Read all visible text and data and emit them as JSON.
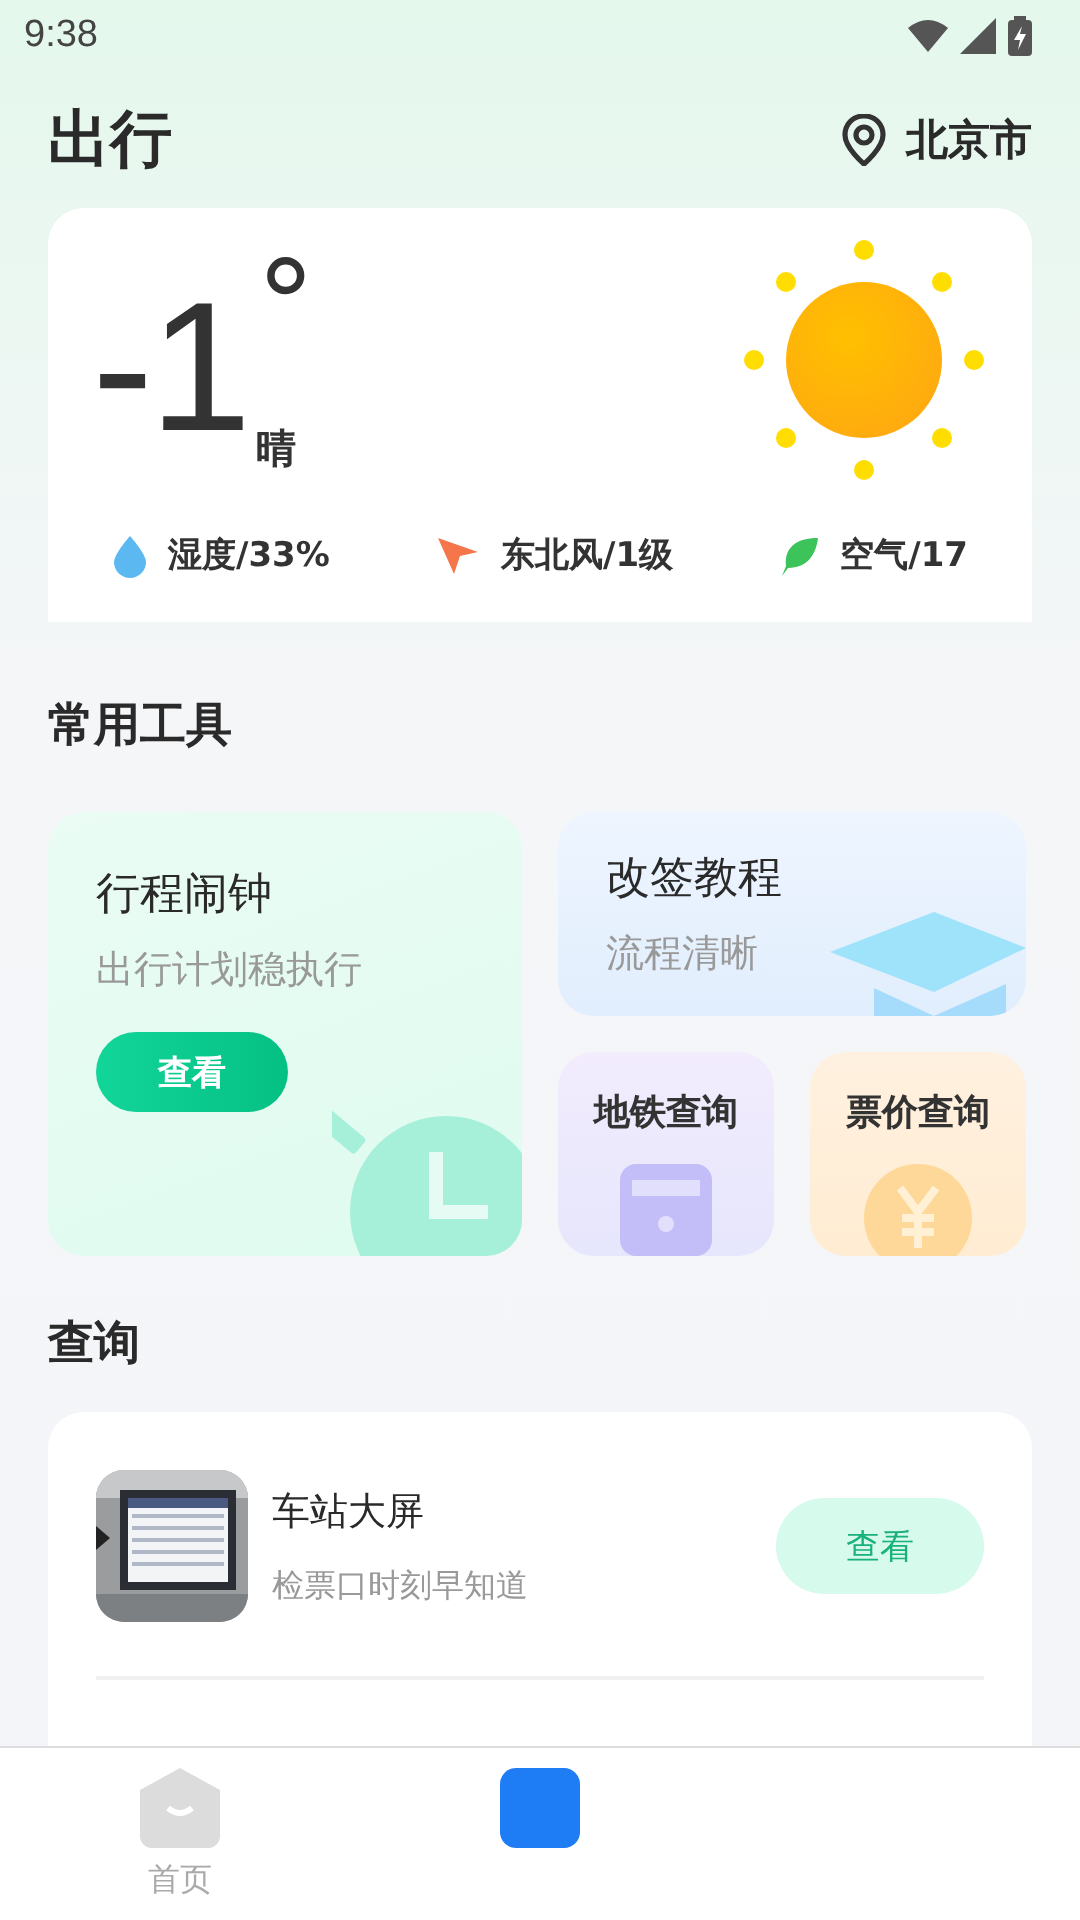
{
  "status_bar": {
    "time": "9:38"
  },
  "header": {
    "title": "出行",
    "location": "北京市"
  },
  "weather": {
    "temperature": "-1",
    "degree": "°",
    "condition": "晴",
    "stats": [
      {
        "kind": "humidity",
        "text": "湿度/33%"
      },
      {
        "kind": "wind",
        "text": "东北风/1级"
      },
      {
        "kind": "air",
        "text": "空气/17"
      }
    ]
  },
  "tools_section": {
    "title": "常用工具"
  },
  "tools": [
    {
      "kind": "alarm",
      "title": "行程闹钟",
      "subtitle": "出行计划稳执行",
      "button": "查看"
    },
    {
      "kind": "tutorial",
      "title": "改签教程",
      "subtitle": "流程清晰"
    },
    {
      "kind": "metro",
      "title": "地铁查询"
    },
    {
      "kind": "fare",
      "title": "票价查询"
    }
  ],
  "query_section": {
    "title": "查询"
  },
  "query_items": [
    {
      "kind": "picture",
      "title": "车站大屏",
      "subtitle": "检票口时刻早知道",
      "button": "查看"
    }
  ],
  "nav": [
    {
      "label": "首页",
      "selected": false
    },
    {
      "selected": true
    }
  ]
}
